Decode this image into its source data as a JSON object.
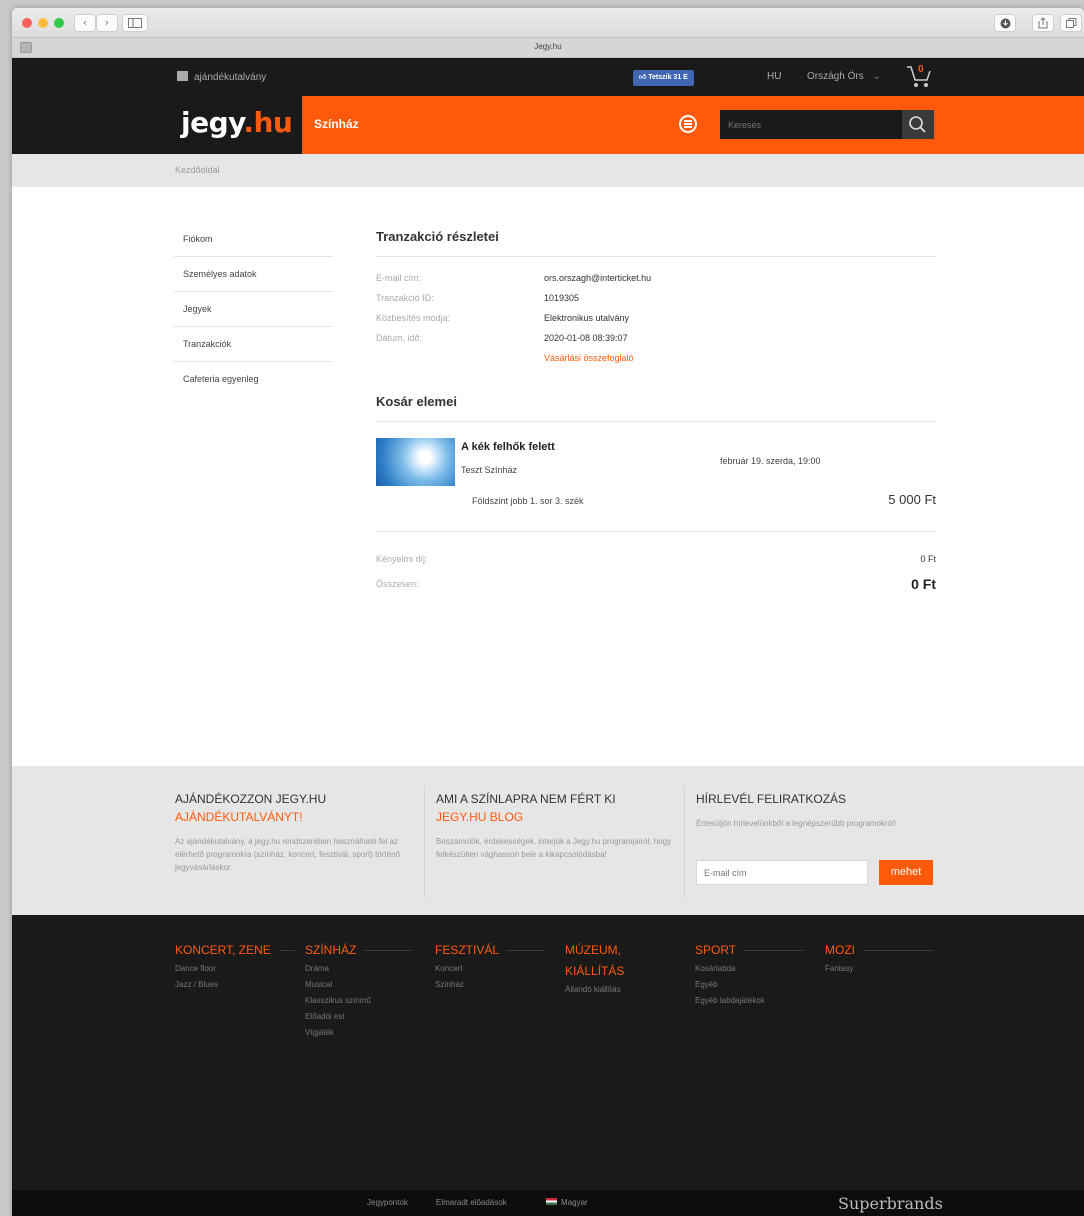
{
  "browser": {
    "tab_title": "Jegy.hu",
    "back": "‹",
    "forward": "›"
  },
  "topbar": {
    "gift_link": "ajándékutalvány",
    "fb_like": "Tetszik 31 E",
    "lang": "HU",
    "user": "Országh Örs",
    "user_caret": "⌄",
    "cart_count": "0"
  },
  "header": {
    "logo_main": "jegy",
    "logo_accent": ".hu",
    "section": "Színház",
    "search_placeholder": "Keresés"
  },
  "breadcrumb": "Kezdőoldal",
  "sidebar": {
    "items": [
      {
        "label": "Fiókom"
      },
      {
        "label": "Személyes adatok"
      },
      {
        "label": "Jegyek"
      },
      {
        "label": "Tranzakciók"
      },
      {
        "label": "Cafeteria egyenleg"
      }
    ]
  },
  "transaction": {
    "title": "Tranzakció részletei",
    "rows": [
      {
        "label": "E-mail cím:",
        "value": "ors.orszagh@interticket.hu"
      },
      {
        "label": "Tranzakció ID:",
        "value": "1019305"
      },
      {
        "label": "Közbesítés módja:",
        "value": "Elektronikus utalvány"
      },
      {
        "label": "Dátum, idő:",
        "value": "2020-01-08 08:39:07"
      }
    ],
    "summary_link": "Vásárlási összefoglaló"
  },
  "basket": {
    "title": "Kosár elemei",
    "item": {
      "title": "A kék felhők felett",
      "venue": "Teszt Színház",
      "date": "február 19. szerda, 19:00",
      "seat": "Földszint jobb 1. sor 3. szék",
      "price": "5 000 Ft"
    },
    "fee_label": "Kényelmi díj:",
    "fee_value": "0 Ft",
    "total_label": "Összesen:",
    "total_value": "0 Ft"
  },
  "promo": {
    "col1": {
      "heading": "AJÁNDÉKOZZON JEGY.HU",
      "accent": "AJÁNDÉKUTALVÁNYT!",
      "text": "Az ajándékutalvány, a jegy.hu rendszerében használható fel az elérhető programokra (színház, koncert, fesztivál, sport) történő jegyvásárláskor."
    },
    "col2": {
      "heading": "AMI A SZÍNLAPRA NEM FÉRT KI",
      "accent": "JEGY.HU BLOG",
      "text": "Beszámolók, érdekességek, interjúk a Jegy.hu programjairól, hogy felkészülten vághasson bele a kikapcsolódásba!"
    },
    "col3": {
      "heading": "HÍRLEVÉL FELIRATKOZÁS",
      "text": "Értesüljön hírlevelünkből a legnépszerűbb programokról!",
      "email_placeholder": "E-mail cím",
      "button": "mehet"
    }
  },
  "footer": {
    "columns": [
      {
        "heading": "KONCERT, ZENE",
        "links": [
          "Dance floor",
          "Jazz / Blues"
        ]
      },
      {
        "heading": "SZÍNHÁZ",
        "links": [
          "Dráma",
          "Musical",
          "Klasszikus színmű",
          "Előadói est",
          "Vígjáték"
        ]
      },
      {
        "heading": "FESZTIVÁL",
        "links": [
          "Koncert",
          "Színház"
        ]
      },
      {
        "heading": "MÚZEUM, KIÁLLÍTÁS",
        "links": [
          "Állandó kiállítás"
        ]
      },
      {
        "heading": "SPORT",
        "links": [
          "Kosárlabda",
          "Egyéb",
          "Egyéb labdajátékok"
        ]
      },
      {
        "heading": "MOZI",
        "links": [
          "Fantasy"
        ]
      }
    ],
    "bottom": {
      "link1": "Jegypontok",
      "link2": "Elmaradt előadások",
      "lang": "Magyar",
      "brand": "Superbrands"
    }
  },
  "colors": {
    "accent": "#ff5a0b",
    "dark": "#1a1a1a"
  }
}
